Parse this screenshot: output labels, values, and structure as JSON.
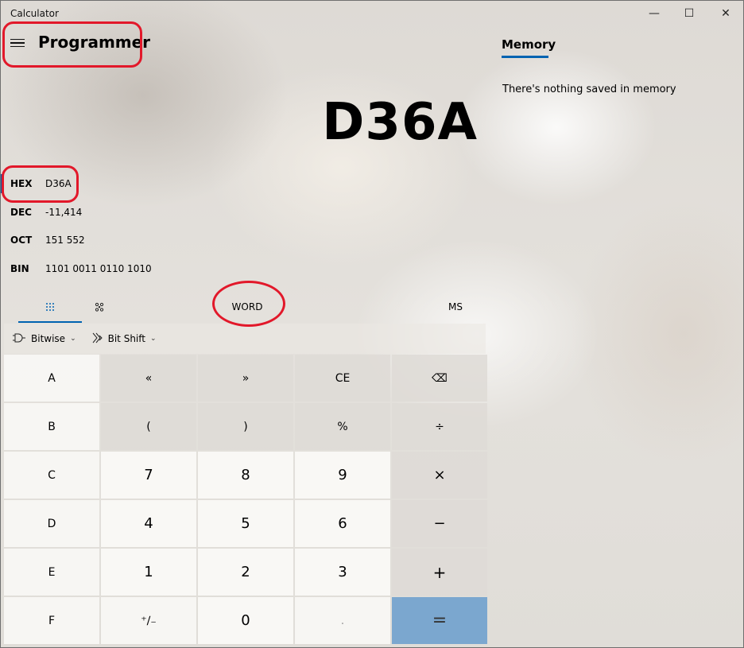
{
  "window": {
    "title": "Calculator",
    "minimize_glyph": "—",
    "maximize_glyph": "☐",
    "close_glyph": "✕"
  },
  "header": {
    "menu_icon": "hamburger-icon",
    "mode": "Programmer"
  },
  "display": {
    "value": "D36A"
  },
  "radix": [
    {
      "name": "HEX",
      "value": "D36A",
      "active": true
    },
    {
      "name": "DEC",
      "value": "-11,414",
      "active": false
    },
    {
      "name": "OCT",
      "value": "151 552",
      "active": false
    },
    {
      "name": "BIN",
      "value": "1101 0011 0110 1010",
      "active": false
    }
  ],
  "tabs": {
    "keypad_icon": "full-keypad-icon",
    "bits_icon": "bit-toggling-keypad-icon",
    "word_size": "WORD",
    "memory_store": "MS"
  },
  "strip": {
    "bitwise_icon": "logic-gate-icon",
    "bitwise": "Bitwise",
    "bitshift_icon": "bit-shift-icon",
    "bitshift": "Bit Shift",
    "chevron": "⌄"
  },
  "keys": [
    [
      "A",
      "«",
      "»",
      "CE",
      "⌫"
    ],
    [
      "B",
      "(",
      ")",
      "%",
      "÷"
    ],
    [
      "C",
      "7",
      "8",
      "9",
      "×"
    ],
    [
      "D",
      "4",
      "5",
      "6",
      "−"
    ],
    [
      "E",
      "1",
      "2",
      "3",
      "+"
    ],
    [
      "F",
      "⁺∕₋",
      "0",
      ".",
      "="
    ]
  ],
  "memory": {
    "tab_label": "Memory",
    "empty_text": "There's nothing saved in memory"
  },
  "colors": {
    "accent": "#0063b1",
    "equals_key": "#7ba7cf",
    "annotation": "#e2182a"
  }
}
